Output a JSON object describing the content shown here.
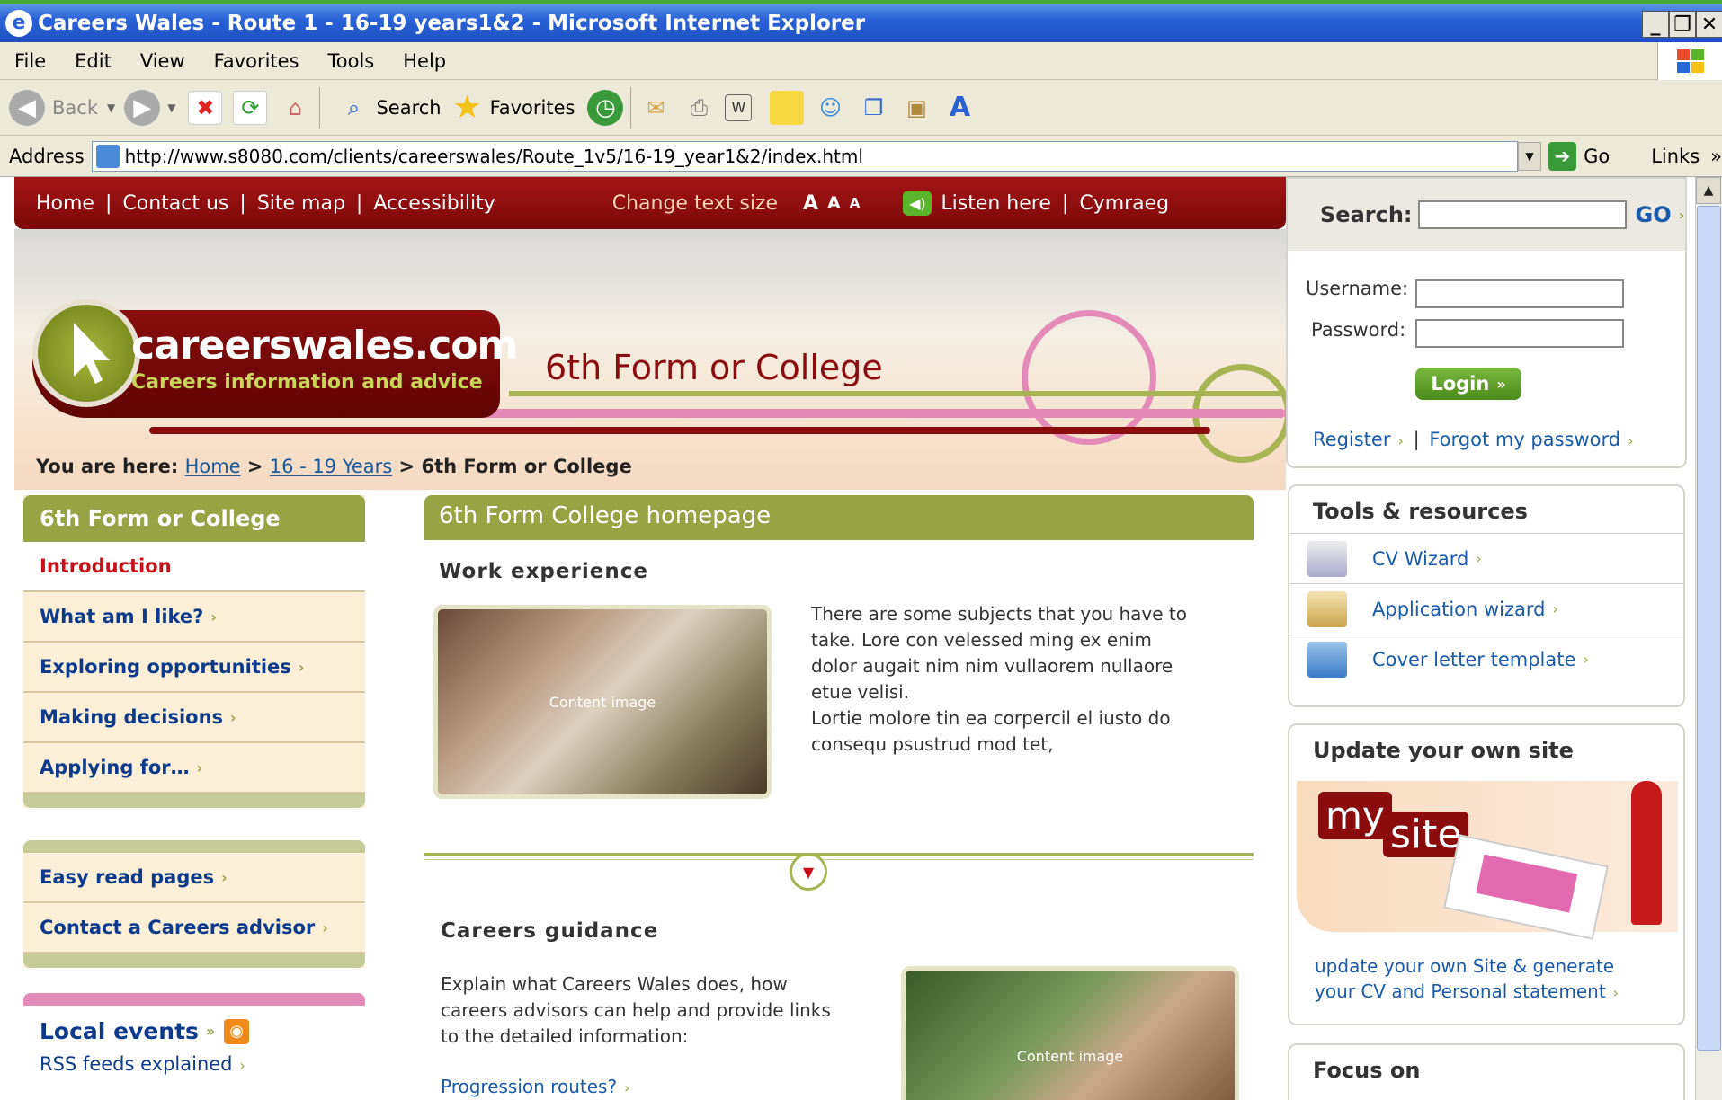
{
  "window": {
    "title": "Careers Wales - Route 1 - 16-19 years1&2 - Microsoft Internet Explorer"
  },
  "menu": [
    "File",
    "Edit",
    "View",
    "Favorites",
    "Tools",
    "Help"
  ],
  "toolbar": {
    "back": "Back",
    "search": "Search",
    "favorites": "Favorites"
  },
  "address": {
    "label": "Address",
    "url": "http://www.s8080.com/clients/careerswales/Route_1v5/16-19_year1&2/index.html",
    "go": "Go",
    "links": "Links"
  },
  "topnav": {
    "home": "Home",
    "contact": "Contact us",
    "sitemap": "Site map",
    "accessibility": "Accessibility",
    "text_size": "Change text size",
    "sizes": [
      "A",
      "A",
      "A"
    ],
    "listen": "Listen here",
    "cymraeg": "Cymraeg"
  },
  "logo": {
    "name": "careerswales.com",
    "tagline": "Careers information and advice"
  },
  "section_title": "6th Form or College",
  "breadcrumb": {
    "label": "You are here:",
    "home": "Home",
    "level": "16 - 19 Years",
    "current": "6th Form or College"
  },
  "leftnav": {
    "title": "6th Form or College",
    "items": [
      "Introduction",
      "What am I like?",
      "Exploring opportunities",
      "Making decisions",
      "Applying for…"
    ],
    "extra": [
      "Easy read pages",
      "Contact a Careers advisor"
    ],
    "events": "Local events",
    "rss": "RSS feeds explained"
  },
  "main": {
    "title": "6th Form College homepage",
    "work_title": "Work experience",
    "work_p1": "There are some subjects that you have to take. Lore con velessed ming ex enim dolor augait nim nim vullaorem nullaore etue velisi.",
    "work_p2": "Lortie molore tin ea corpercil el iusto do consequ psustrud mod tet,",
    "image_label": "Content image",
    "guidance_title": "Careers guidance",
    "guidance_p": "Explain what Careers Wales does, how careers advisors can help and provide links to the detailed information:",
    "progression": "Progression routes?"
  },
  "login": {
    "search_label": "Search:",
    "go": "GO",
    "username": "Username:",
    "password": "Password:",
    "button": "Login",
    "register": "Register",
    "forgot": "Forgot my password"
  },
  "tools": {
    "title": "Tools & resources",
    "items": [
      "CV Wizard",
      "Application wizard",
      "Cover letter template"
    ]
  },
  "mysite": {
    "title": "Update your own site",
    "logo_my": "my",
    "logo_site": "site",
    "text": "update your own Site & generate your CV and Personal statement"
  },
  "focus": {
    "title": "Focus on"
  },
  "colors": {
    "brand_red": "#8a0c0c",
    "olive": "#96a446",
    "link": "#1a5aaa"
  }
}
